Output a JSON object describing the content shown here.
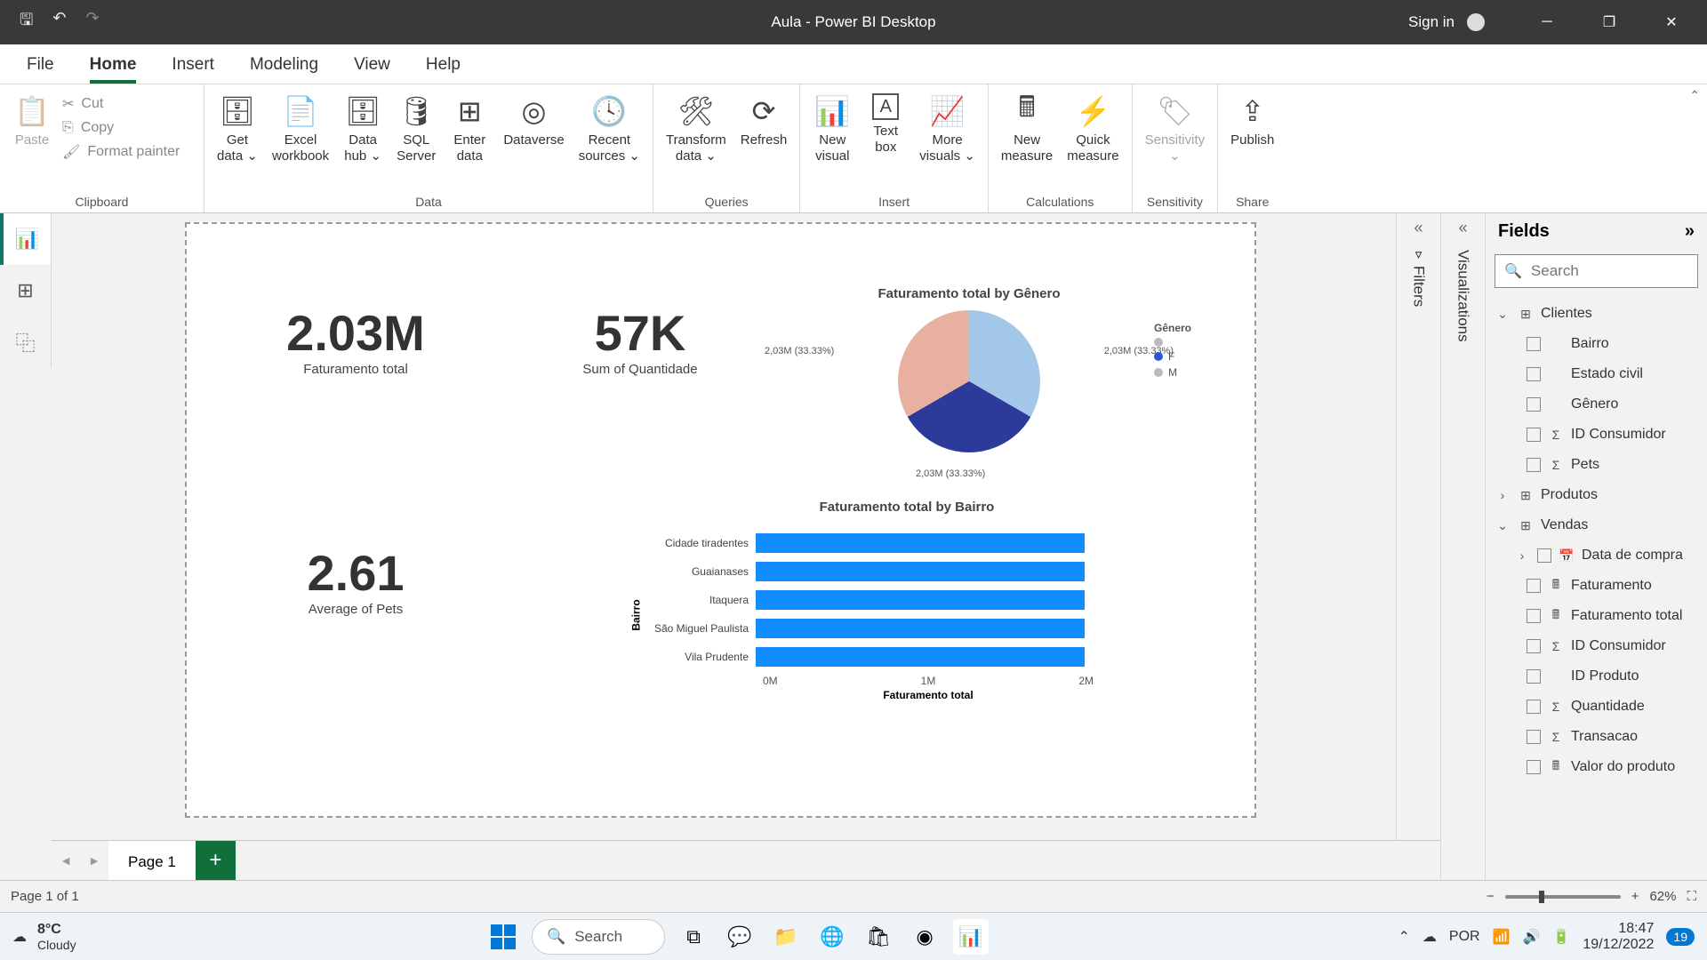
{
  "titlebar": {
    "title": "Aula - Power BI Desktop",
    "signin": "Sign in"
  },
  "menu": {
    "file": "File",
    "home": "Home",
    "insert": "Insert",
    "modeling": "Modeling",
    "view": "View",
    "help": "Help"
  },
  "ribbon": {
    "clipboard": {
      "paste": "Paste",
      "cut": "Cut",
      "copy": "Copy",
      "format": "Format painter",
      "label": "Clipboard"
    },
    "data": {
      "get": "Get\ndata ⌄",
      "excel": "Excel\nworkbook",
      "hub": "Data\nhub ⌄",
      "sql": "SQL\nServer",
      "enter": "Enter\ndata",
      "dataverse": "Dataverse",
      "recent": "Recent\nsources ⌄",
      "label": "Data"
    },
    "queries": {
      "transform": "Transform\ndata ⌄",
      "refresh": "Refresh",
      "label": "Queries"
    },
    "ins": {
      "newv": "New\nvisual",
      "text": "Text\nbox",
      "more": "More\nvisuals ⌄",
      "label": "Insert"
    },
    "calc": {
      "newm": "New\nmeasure",
      "quick": "Quick\nmeasure",
      "label": "Calculations"
    },
    "sens": {
      "btn": "Sensitivity\n⌄",
      "label": "Sensitivity"
    },
    "share": {
      "publish": "Publish",
      "label": "Share"
    }
  },
  "collapsed": {
    "filters": "Filters",
    "viz": "Visualizations"
  },
  "fields": {
    "title": "Fields",
    "search_ph": "Search",
    "tables": {
      "clientes": "Clientes",
      "clientes_fields": {
        "bairro": "Bairro",
        "estado": "Estado civil",
        "genero": "Gênero",
        "idc": "ID Consumidor",
        "pets": "Pets"
      },
      "produtos": "Produtos",
      "vendas": "Vendas",
      "vendas_fields": {
        "data": "Data de compra",
        "fat": "Faturamento",
        "fattot": "Faturamento total",
        "idc": "ID Consumidor",
        "idp": "ID Produto",
        "qtd": "Quantidade",
        "trans": "Transacao",
        "valor": "Valor do produto"
      }
    }
  },
  "cards": {
    "fat": {
      "val": "2.03M",
      "lab": "Faturamento total"
    },
    "qtd": {
      "val": "57K",
      "lab": "Sum of Quantidade"
    },
    "pets": {
      "val": "2.61",
      "lab": "Average of Pets"
    }
  },
  "pie": {
    "title": "Faturamento total by Gênero",
    "label1": "2,03M (33.33%)",
    "label2": "2,03M (33.33%)",
    "label3": "2,03M (33.33%)",
    "legend_hdr": "Gênero",
    "legend": {
      "blank": "",
      "f": "F",
      "m": "M"
    }
  },
  "bar": {
    "title": "Faturamento total by Bairro",
    "ytitle": "Bairro",
    "xtitle": "Faturamento total",
    "ticks": {
      "t0": "0M",
      "t1": "1M",
      "t2": "2M"
    },
    "rows": {
      "r0": "Cidade tiradentes",
      "r1": "Guaianases",
      "r2": "Itaquera",
      "r3": "São Miguel Paulista",
      "r4": "Vila Prudente"
    }
  },
  "pages": {
    "p1": "Page 1",
    "status": "Page 1 of 1"
  },
  "zoom": "62%",
  "taskbar": {
    "temp": "8°C",
    "weather": "Cloudy",
    "search": "Search",
    "lang": "POR",
    "time": "18:47",
    "date": "19/12/2022",
    "notif": "19"
  },
  "chart_data": [
    {
      "type": "pie",
      "title": "Faturamento total by Gênero",
      "series": [
        {
          "name": "",
          "value": 2030000,
          "pct": 33.33
        },
        {
          "name": "F",
          "value": 2030000,
          "pct": 33.33
        },
        {
          "name": "M",
          "value": 2030000,
          "pct": 33.33
        }
      ]
    },
    {
      "type": "bar",
      "orientation": "horizontal",
      "title": "Faturamento total by Bairro",
      "xlabel": "Faturamento total",
      "ylabel": "Bairro",
      "xlim": [
        0,
        2000000
      ],
      "categories": [
        "Cidade tiradentes",
        "Guaianases",
        "Itaquera",
        "São Miguel Paulista",
        "Vila Prudente"
      ],
      "values": [
        2000000,
        2000000,
        2000000,
        2000000,
        2000000
      ]
    }
  ]
}
